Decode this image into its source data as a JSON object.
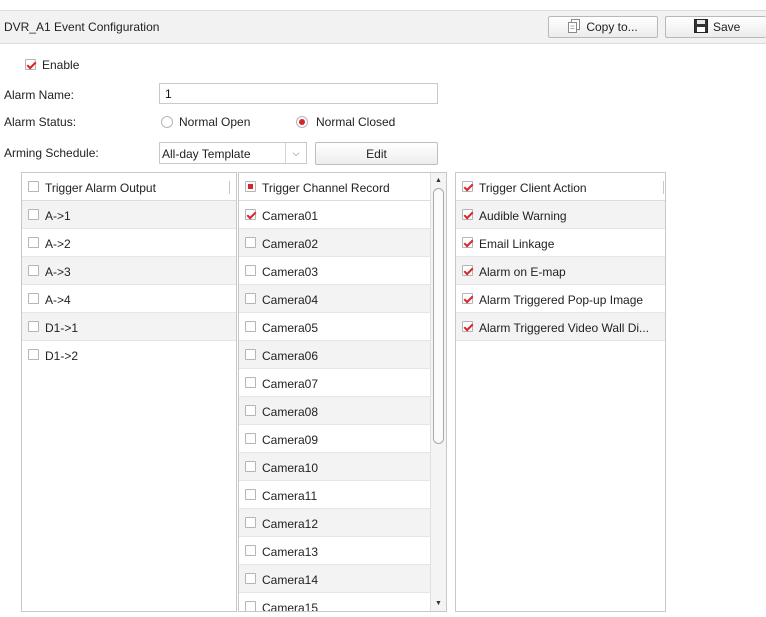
{
  "header": {
    "title": "DVR_A1 Event Configuration",
    "copy_label": "Copy to...",
    "save_label": "Save"
  },
  "form": {
    "enable_label": "Enable",
    "enable_checked": true,
    "alarm_name_label": "Alarm Name:",
    "alarm_name_value": "1",
    "alarm_status_label": "Alarm Status:",
    "status_options": [
      "Normal Open",
      "Normal Closed"
    ],
    "status_selected": "Normal Closed",
    "arming_schedule_label": "Arming Schedule:",
    "arming_schedule_value": "All-day Template",
    "edit_label": "Edit"
  },
  "alarm_output": {
    "header": "Trigger Alarm Output",
    "items": [
      {
        "label": "A->1",
        "checked": false
      },
      {
        "label": "A->2",
        "checked": false
      },
      {
        "label": "A->3",
        "checked": false
      },
      {
        "label": "A->4",
        "checked": false
      },
      {
        "label": "D1->1",
        "checked": false
      },
      {
        "label": "D1->2",
        "checked": false
      }
    ]
  },
  "channel_record": {
    "header": "Trigger Channel Record",
    "items": [
      {
        "label": "Camera01",
        "checked": true
      },
      {
        "label": "Camera02",
        "checked": false
      },
      {
        "label": "Camera03",
        "checked": false
      },
      {
        "label": "Camera04",
        "checked": false
      },
      {
        "label": "Camera05",
        "checked": false
      },
      {
        "label": "Camera06",
        "checked": false
      },
      {
        "label": "Camera07",
        "checked": false
      },
      {
        "label": "Camera08",
        "checked": false
      },
      {
        "label": "Camera09",
        "checked": false
      },
      {
        "label": "Camera10",
        "checked": false
      },
      {
        "label": "Camera11",
        "checked": false
      },
      {
        "label": "Camera12",
        "checked": false
      },
      {
        "label": "Camera13",
        "checked": false
      },
      {
        "label": "Camera14",
        "checked": false
      },
      {
        "label": "Camera15",
        "checked": false
      }
    ]
  },
  "client_action": {
    "header": "Trigger Client Action",
    "items": [
      {
        "label": "Audible Warning",
        "checked": true
      },
      {
        "label": "Email Linkage",
        "checked": true
      },
      {
        "label": "Alarm on E-map",
        "checked": true
      },
      {
        "label": "Alarm Triggered Pop-up Image",
        "checked": true
      },
      {
        "label": "Alarm Triggered Video Wall Di...",
        "checked": true
      }
    ]
  },
  "colors": {
    "accent": "#d6262b",
    "header_bg": "#f2f2f2",
    "alt_row": "#f3f3f3"
  },
  "icons": {
    "copy": "copy-document-icon",
    "save": "floppy-disk-icon"
  }
}
